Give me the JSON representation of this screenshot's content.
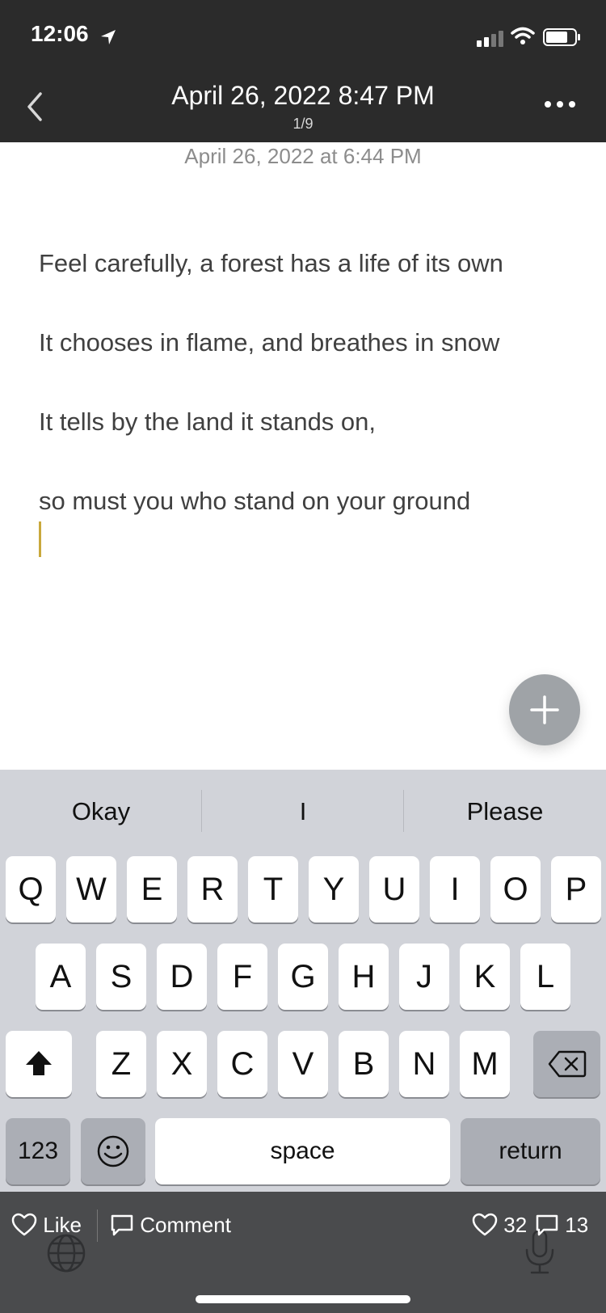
{
  "status_bar": {
    "time": "12:06"
  },
  "nav": {
    "title": "April 26, 2022 8:47 PM",
    "subtitle": "1/9"
  },
  "note": {
    "timestamp": "April 26, 2022 at 6:44 PM",
    "lines": [
      "Feel carefully, a forest has a life of its own",
      "It chooses in flame, and breathes in snow",
      "It tells by the land it stands on,",
      "so must you who stand on your ground"
    ]
  },
  "keyboard": {
    "suggestions": [
      "Okay",
      "I",
      "Please"
    ],
    "row1": [
      "Q",
      "W",
      "E",
      "R",
      "T",
      "Y",
      "U",
      "I",
      "O",
      "P"
    ],
    "row2": [
      "A",
      "S",
      "D",
      "F",
      "G",
      "H",
      "J",
      "K",
      "L"
    ],
    "row3": [
      "Z",
      "X",
      "C",
      "V",
      "B",
      "N",
      "M"
    ],
    "numbers_label": "123",
    "space_label": "space",
    "return_label": "return"
  },
  "bottom_bar": {
    "like_label": "Like",
    "comment_label": "Comment",
    "likes_count": "32",
    "comments_count": "13"
  },
  "colors": {
    "accent_cursor": "#c9a83c",
    "topbar": "#2b2b2b",
    "fab": "#9fa3a7"
  }
}
